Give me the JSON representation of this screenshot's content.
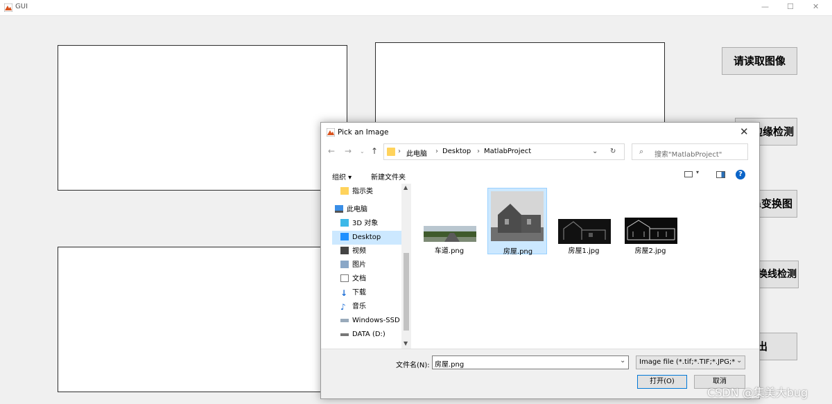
{
  "window": {
    "title": "GUI"
  },
  "buttons": {
    "read_image": "请读取图像",
    "edge_detect": "边缘检测",
    "hough_transform": "h变换图",
    "hough_line_detect": "变换线检测",
    "exit": "退出"
  },
  "dialog": {
    "title": "Pick an Image",
    "breadcrumb": [
      "此电脑",
      "Desktop",
      "MatlabProject"
    ],
    "search_placeholder": "搜索\"MatlabProject\"",
    "toolbar": {
      "organize": "组织 ▾",
      "new_folder": "新建文件夹"
    },
    "nav_items": [
      {
        "label": "指示类",
        "icon": "folder-icon"
      },
      {
        "label": "此电脑",
        "icon": "computer-icon"
      },
      {
        "label": "3D 对象",
        "icon": "cube-icon"
      },
      {
        "label": "Desktop",
        "icon": "desktop-icon"
      },
      {
        "label": "视频",
        "icon": "video-icon"
      },
      {
        "label": "图片",
        "icon": "pictures-icon"
      },
      {
        "label": "文档",
        "icon": "documents-icon"
      },
      {
        "label": "下载",
        "icon": "download-icon"
      },
      {
        "label": "音乐",
        "icon": "music-icon"
      },
      {
        "label": "Windows-SSD",
        "icon": "drive-icon"
      },
      {
        "label": "DATA (D:)",
        "icon": "drive-icon"
      }
    ],
    "files": [
      {
        "name": "车道.png"
      },
      {
        "name": "房屋.png"
      },
      {
        "name": "房屋1.jpg"
      },
      {
        "name": "房屋2.jpg"
      }
    ],
    "filename_label": "文件名(N):",
    "filename_value": "房屋.png",
    "filetype_value": "Image file (*.tif;*.TIF;*.JPG;*.jp",
    "open_label": "打开(O)",
    "cancel_label": "取消"
  },
  "watermark": "CSDN @集美大bug",
  "colors": {
    "selection": "#cce8ff",
    "accent": "#0a64c8"
  }
}
